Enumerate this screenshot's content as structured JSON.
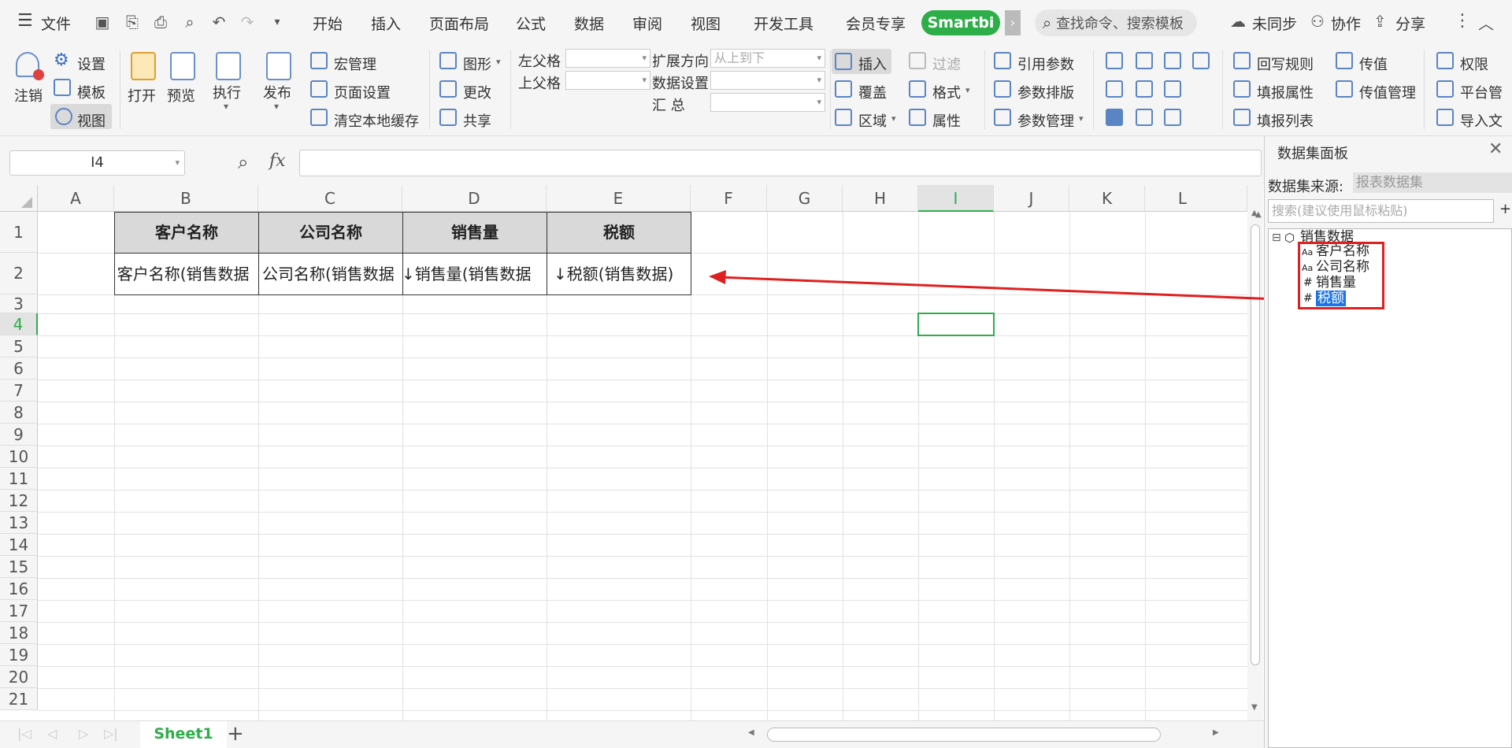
{
  "menubar": {
    "file": "文件",
    "tabs": [
      "开始",
      "插入",
      "页面布局",
      "公式",
      "数据",
      "审阅",
      "视图",
      "开发工具",
      "会员专享"
    ],
    "smartbi": "Smartbi",
    "search": "查找命令、搜索模板",
    "sync": "未同步",
    "collab": "协作",
    "share": "分享"
  },
  "ribbon": {
    "logout": "注销",
    "settings": "设置",
    "template": "模板",
    "view": "视图",
    "open": "打开",
    "preview": "预览",
    "execute": "执行",
    "publish": "发布",
    "macro": "宏管理",
    "page_setup": "页面设置",
    "clear_cache": "清空本地缓存",
    "chart": "图形",
    "change": "更改",
    "share": "共享",
    "left_parent": "左父格",
    "top_parent": "上父格",
    "expand_dir": "扩展方向",
    "expand_dir_value": "从上到下",
    "data_setting": "数据设置",
    "summary": "汇 总",
    "insert": "插入",
    "overwrite": "覆盖",
    "region": "区域",
    "filter": "过滤",
    "format": "格式",
    "property": "属性",
    "ref_param": "引用参数",
    "param_layout": "参数排版",
    "param_manage": "参数管理",
    "writeback": "回写规则",
    "fill_property": "填报属性",
    "fill_list": "填报列表",
    "pass_value": "传值",
    "pass_manage": "传值管理",
    "permission": "权限",
    "platform": "平台管",
    "import": "导入文"
  },
  "formula_bar": {
    "cell_ref": "I4",
    "fx": "fx",
    "value": ""
  },
  "sheet": {
    "columns": [
      "A",
      "B",
      "C",
      "D",
      "E",
      "F",
      "G",
      "H",
      "I",
      "J",
      "K",
      "L"
    ],
    "rows": [
      "1",
      "2",
      "3",
      "4",
      "5",
      "6",
      "7",
      "8",
      "9",
      "10",
      "11",
      "12",
      "13",
      "14",
      "15",
      "16",
      "17",
      "18",
      "19",
      "20",
      "21"
    ],
    "header_cells": [
      "客户名称",
      "公司名称",
      "销售量",
      "税额"
    ],
    "data_cells": [
      "↓客户名称(销售数据",
      "公司名称(销售数据",
      "↓销售量(销售数据",
      "↓税额(销售数据)"
    ],
    "tab": "Sheet1"
  },
  "panel": {
    "title": "数据集面板",
    "source_label": "数据集来源:",
    "source_value": "报表数据集",
    "search_placeholder": "搜索(建议使用鼠标粘贴)",
    "root": "销售数据",
    "fields": [
      {
        "type": "Aa",
        "name": "客户名称"
      },
      {
        "type": "Aa",
        "name": "公司名称"
      },
      {
        "type": "#",
        "name": "销售量"
      },
      {
        "type": "#",
        "name": "税额"
      }
    ]
  },
  "colors": {
    "accent": "#2eae48",
    "annotation": "#e02020",
    "selection": "#1a73e8"
  }
}
